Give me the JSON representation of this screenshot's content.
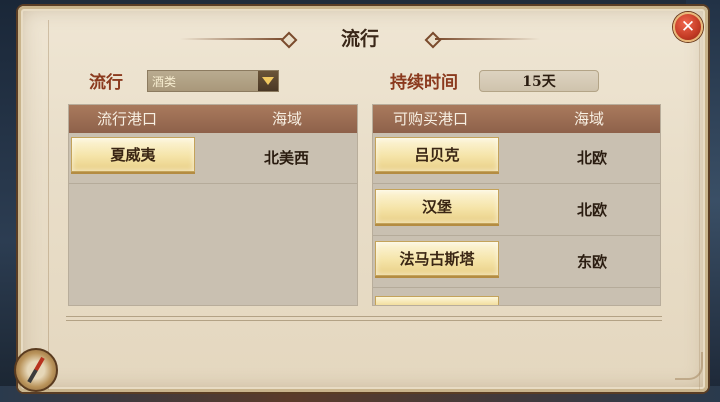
{
  "window": {
    "title": "流行",
    "close_icon": "close-icon"
  },
  "filter": {
    "label": "流行",
    "selected": "酒类"
  },
  "duration": {
    "label": "持续时间",
    "value": "15天"
  },
  "popular_ports": {
    "headers": [
      "流行港口",
      "海域"
    ],
    "rows": [
      {
        "port": "夏威夷",
        "region": "北美西"
      }
    ]
  },
  "purchase_ports": {
    "headers": [
      "可购买港口",
      "海域"
    ],
    "rows": [
      {
        "port": "吕贝克",
        "region": "北欧"
      },
      {
        "port": "汉堡",
        "region": "北欧"
      },
      {
        "port": "法马古斯塔",
        "region": "东欧"
      }
    ]
  },
  "colors": {
    "header_bg": "#8e614a",
    "label_red": "#8b3a1e",
    "close_red": "#c43b25"
  }
}
